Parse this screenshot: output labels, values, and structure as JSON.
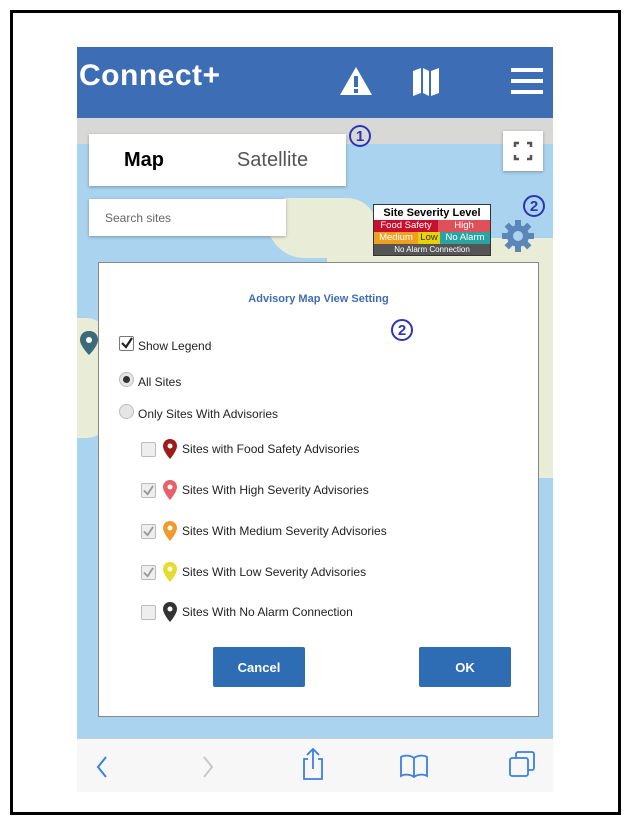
{
  "header": {
    "brand": "Connect+",
    "icons": [
      "warning-icon",
      "map-icon",
      "menu-icon"
    ]
  },
  "map": {
    "map_tab": "Map",
    "satellite_tab": "Satellite",
    "search_placeholder": "Search sites",
    "legend": {
      "title": "Site Severity Level",
      "rows": [
        [
          {
            "label": "Food Safety",
            "color": "#c8102e"
          },
          {
            "label": "High",
            "color": "#e0505a"
          }
        ],
        [
          {
            "label": "Medium",
            "color": "#f0a020"
          },
          {
            "label": "Low",
            "color": "#e8d300"
          },
          {
            "label": "No Alarm",
            "color": "#2aa3a3"
          }
        ]
      ],
      "cut_row": "No Alarm Connection"
    },
    "callouts": [
      "1",
      "2"
    ]
  },
  "dialog": {
    "title": "Advisory Map View Setting",
    "callout": "2",
    "show_legend": {
      "label": "Show Legend",
      "checked": true
    },
    "all_sites": {
      "label": "All Sites",
      "selected": true
    },
    "only_advisories": {
      "label": "Only Sites With Advisories",
      "selected": false
    },
    "filters": [
      {
        "label": "Sites with Food Safety Advisories",
        "checked": false,
        "pin_color": "#9e1b1b"
      },
      {
        "label": "Sites With High Severity Advisories",
        "checked": true,
        "pin_color": "#e8606a"
      },
      {
        "label": "Sites With Medium Severity Advisories",
        "checked": true,
        "pin_color": "#f19a2c"
      },
      {
        "label": "Sites With Low Severity Advisories",
        "checked": true,
        "pin_color": "#e6dc2a"
      },
      {
        "label": "Sites With No Alarm Connection",
        "checked": false,
        "pin_color": "#333333"
      }
    ],
    "cancel_label": "Cancel",
    "ok_label": "OK"
  },
  "browser": {
    "icons": [
      "back-icon",
      "forward-icon",
      "share-icon",
      "bookmarks-icon",
      "tabs-icon"
    ]
  }
}
